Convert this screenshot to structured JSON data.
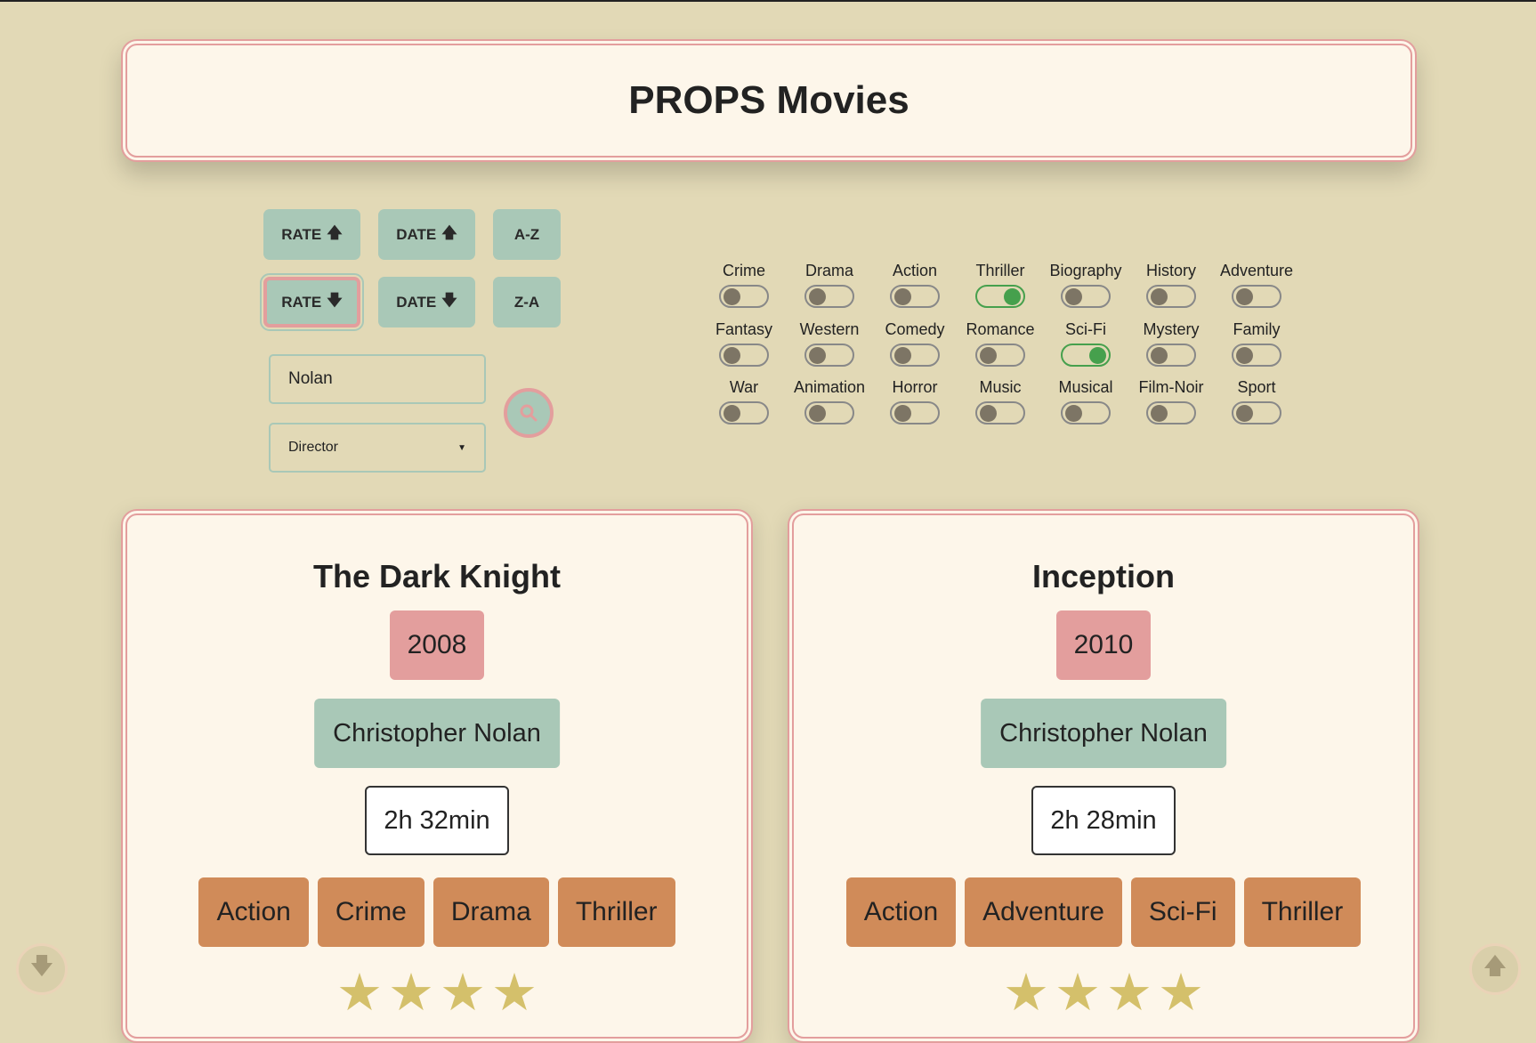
{
  "header": {
    "title": "PROPS Movies"
  },
  "sort": {
    "rate_up": "RATE",
    "date_up": "DATE",
    "az": "A-Z",
    "rate_down": "RATE",
    "date_down": "DATE",
    "za": "Z-A"
  },
  "search": {
    "value": "Nolan",
    "filter_selected": "Director"
  },
  "genres": [
    {
      "label": "Crime",
      "on": false
    },
    {
      "label": "Drama",
      "on": false
    },
    {
      "label": "Action",
      "on": false
    },
    {
      "label": "Thriller",
      "on": true
    },
    {
      "label": "Biography",
      "on": false
    },
    {
      "label": "History",
      "on": false
    },
    {
      "label": "Adventure",
      "on": false
    },
    {
      "label": "Fantasy",
      "on": false
    },
    {
      "label": "Western",
      "on": false
    },
    {
      "label": "Comedy",
      "on": false
    },
    {
      "label": "Romance",
      "on": false
    },
    {
      "label": "Sci-Fi",
      "on": true
    },
    {
      "label": "Mystery",
      "on": false
    },
    {
      "label": "Family",
      "on": false
    },
    {
      "label": "War",
      "on": false
    },
    {
      "label": "Animation",
      "on": false
    },
    {
      "label": "Horror",
      "on": false
    },
    {
      "label": "Music",
      "on": false
    },
    {
      "label": "Musical",
      "on": false
    },
    {
      "label": "Film-Noir",
      "on": false
    },
    {
      "label": "Sport",
      "on": false
    }
  ],
  "movies": [
    {
      "title": "The Dark Knight",
      "year": "2008",
      "director": "Christopher Nolan",
      "duration": "2h 32min",
      "tags": [
        "Action",
        "Crime",
        "Drama",
        "Thriller"
      ],
      "stars": 4
    },
    {
      "title": "Inception",
      "year": "2010",
      "director": "Christopher Nolan",
      "duration": "2h 28min",
      "tags": [
        "Action",
        "Adventure",
        "Sci-Fi",
        "Thriller"
      ],
      "stars": 4
    }
  ],
  "colors": {
    "background": "#e2d9b6",
    "card": "#fdf6ea",
    "accent_pink": "#e39e9d",
    "accent_green": "#a9c8b7",
    "tag": "#d08b59",
    "star": "#d4c06b",
    "toggle_on": "#46a04d"
  }
}
